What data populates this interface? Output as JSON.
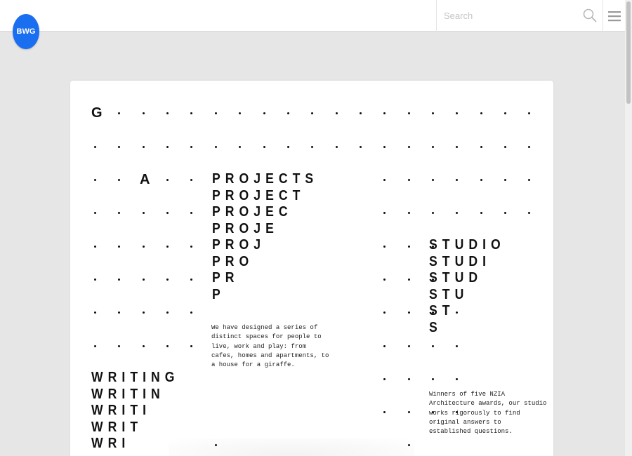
{
  "header": {
    "logo_text": "BWG",
    "search_placeholder": "Search",
    "logo_color": "#1a6ff0"
  },
  "grid": {
    "g_label": "G",
    "a_label": "A"
  },
  "projects": {
    "lines": [
      "PROJECTS",
      "PROJECT",
      "PROJEC",
      "PROJE",
      "PROJ",
      "PRO",
      "PR",
      "P"
    ],
    "description_lines": [
      "We have designed a series of",
      "distinct spaces for people to",
      "live, work and play: from",
      "cafes, homes and apartments, to",
      "a house for a giraffe."
    ]
  },
  "studio": {
    "lines": [
      "STUDIO",
      "STUDI",
      "STUD",
      "STU",
      "ST",
      "S"
    ],
    "description_lines": [
      "Winners of five NZIA",
      "Architecture awards, our studio",
      "works rigorously to find",
      "original answers to",
      "established questions."
    ]
  },
  "writing": {
    "lines": [
      "WRITING",
      "WRITIN",
      "WRITI",
      "WRIT",
      "WRI"
    ]
  }
}
